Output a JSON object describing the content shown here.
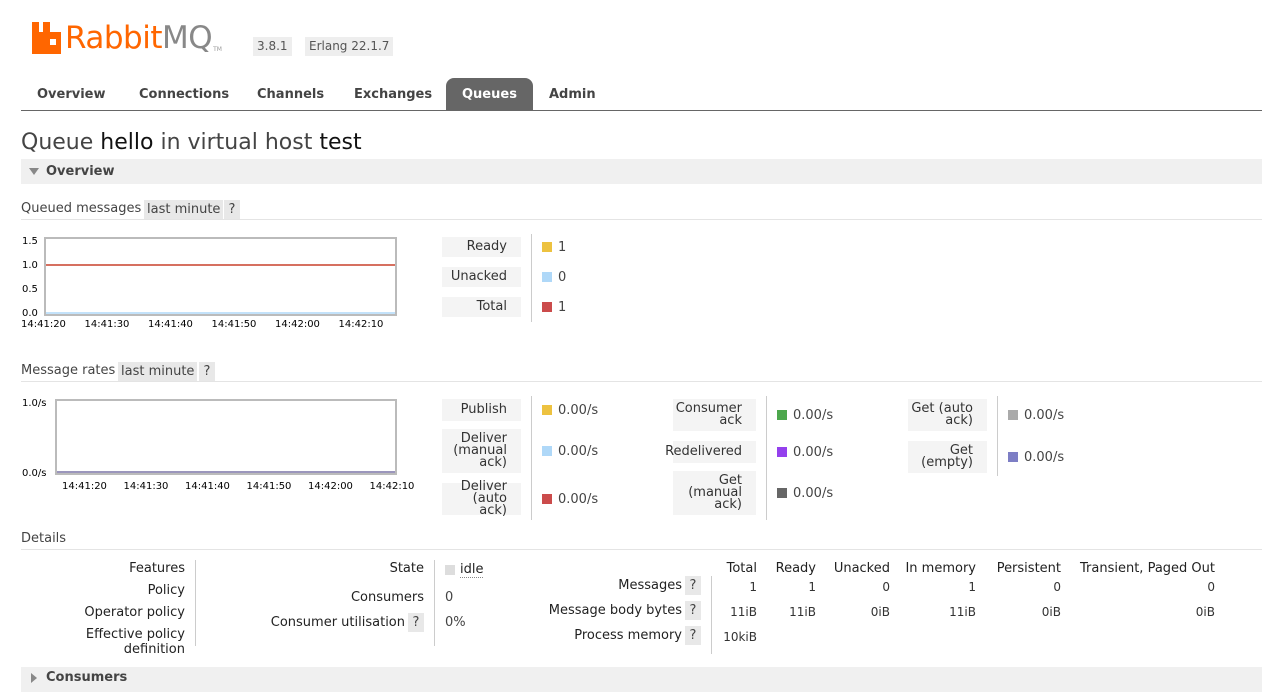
{
  "brand": {
    "logo_text_a": "Rabbit",
    "logo_text_b": "MQ",
    "tm": "TM",
    "version": "3.8.1",
    "erlang": "Erlang 22.1.7"
  },
  "nav": {
    "tabs": [
      "Overview",
      "Connections",
      "Channels",
      "Exchanges",
      "Queues",
      "Admin"
    ],
    "active": "Queues"
  },
  "title": {
    "prefix": "Queue",
    "queue": "hello",
    "mid": "in virtual host",
    "vhost": "test"
  },
  "overview_section": {
    "label": "Overview"
  },
  "queued_messages": {
    "label": "Queued messages",
    "range": "last minute",
    "help": "?",
    "chart_data": {
      "type": "line",
      "x": [
        "14:41:20",
        "14:41:30",
        "14:41:40",
        "14:41:50",
        "14:42:00",
        "14:42:10"
      ],
      "yticks": [
        "1.5",
        "1.0",
        "0.5",
        "0.0"
      ],
      "ylim": [
        0,
        1.5
      ],
      "series": [
        {
          "name": "Ready",
          "color": "#edc240",
          "values": [
            1,
            1,
            1,
            1,
            1,
            1
          ]
        },
        {
          "name": "Unacked",
          "color": "#afd8f8",
          "values": [
            0,
            0,
            0,
            0,
            0,
            0
          ]
        },
        {
          "name": "Total",
          "color": "#cb4b4b",
          "values": [
            1,
            1,
            1,
            1,
            1,
            1
          ]
        }
      ]
    },
    "legend": [
      {
        "label": "Ready",
        "value": "1",
        "color": "#edc240"
      },
      {
        "label": "Unacked",
        "value": "0",
        "color": "#afd8f8"
      },
      {
        "label": "Total",
        "value": "1",
        "color": "#cb4b4b"
      }
    ]
  },
  "message_rates": {
    "label": "Message rates",
    "range": "last minute",
    "help": "?",
    "chart_data": {
      "type": "line",
      "x": [
        "14:41:20",
        "14:41:30",
        "14:41:40",
        "14:41:50",
        "14:42:00",
        "14:42:10"
      ],
      "yticks": [
        "1.0/s",
        "0.0/s"
      ],
      "ylim": [
        0,
        1
      ],
      "series": [
        {
          "name": "Publish",
          "color": "#edc240",
          "values": [
            0,
            0,
            0,
            0,
            0,
            0
          ]
        },
        {
          "name": "Get (empty)",
          "color": "#7d7ec5",
          "values": [
            0,
            0,
            0,
            0,
            0,
            0
          ]
        }
      ]
    },
    "col1": [
      {
        "label": "Publish",
        "value": "0.00/s",
        "color": "#edc240"
      },
      {
        "label": "Deliver\n(manual\nack)",
        "value": "0.00/s",
        "color": "#afd8f8"
      },
      {
        "label": "Deliver\n(auto ack)",
        "value": "0.00/s",
        "color": "#cb4b4b"
      }
    ],
    "col2": [
      {
        "label": "Consumer\nack",
        "value": "0.00/s",
        "color": "#4da74d"
      },
      {
        "label": "Redelivered",
        "value": "0.00/s",
        "color": "#9440ed"
      },
      {
        "label": "Get\n(manual\nack)",
        "value": "0.00/s",
        "color": "#666666"
      }
    ],
    "col3": [
      {
        "label": "Get (auto\nack)",
        "value": "0.00/s",
        "color": "#aaaaaa"
      },
      {
        "label": "Get\n(empty)",
        "value": "0.00/s",
        "color": "#7d7ec5"
      }
    ]
  },
  "details": {
    "label": "Details",
    "left_labels": [
      "Features",
      "Policy",
      "Operator policy",
      "Effective policy definition"
    ],
    "state_label": "State",
    "state_value": "idle",
    "consumers_label": "Consumers",
    "consumers_value": "0",
    "utilisation_label": "Consumer utilisation",
    "utilisation_value": "0%",
    "help": "?",
    "columns": [
      "Total",
      "Ready",
      "Unacked",
      "In memory",
      "Persistent",
      "Transient, Paged Out"
    ],
    "rows": [
      {
        "label": "Messages",
        "values": [
          "1",
          "1",
          "0",
          "1",
          "0",
          "0"
        ]
      },
      {
        "label": "Message body bytes",
        "values": [
          "11iB",
          "11iB",
          "0iB",
          "11iB",
          "0iB",
          "0iB"
        ]
      },
      {
        "label": "Process memory",
        "values": [
          "10kiB",
          "",
          "",
          "",
          "",
          ""
        ]
      }
    ]
  },
  "consumers_section": {
    "label": "Consumers"
  }
}
